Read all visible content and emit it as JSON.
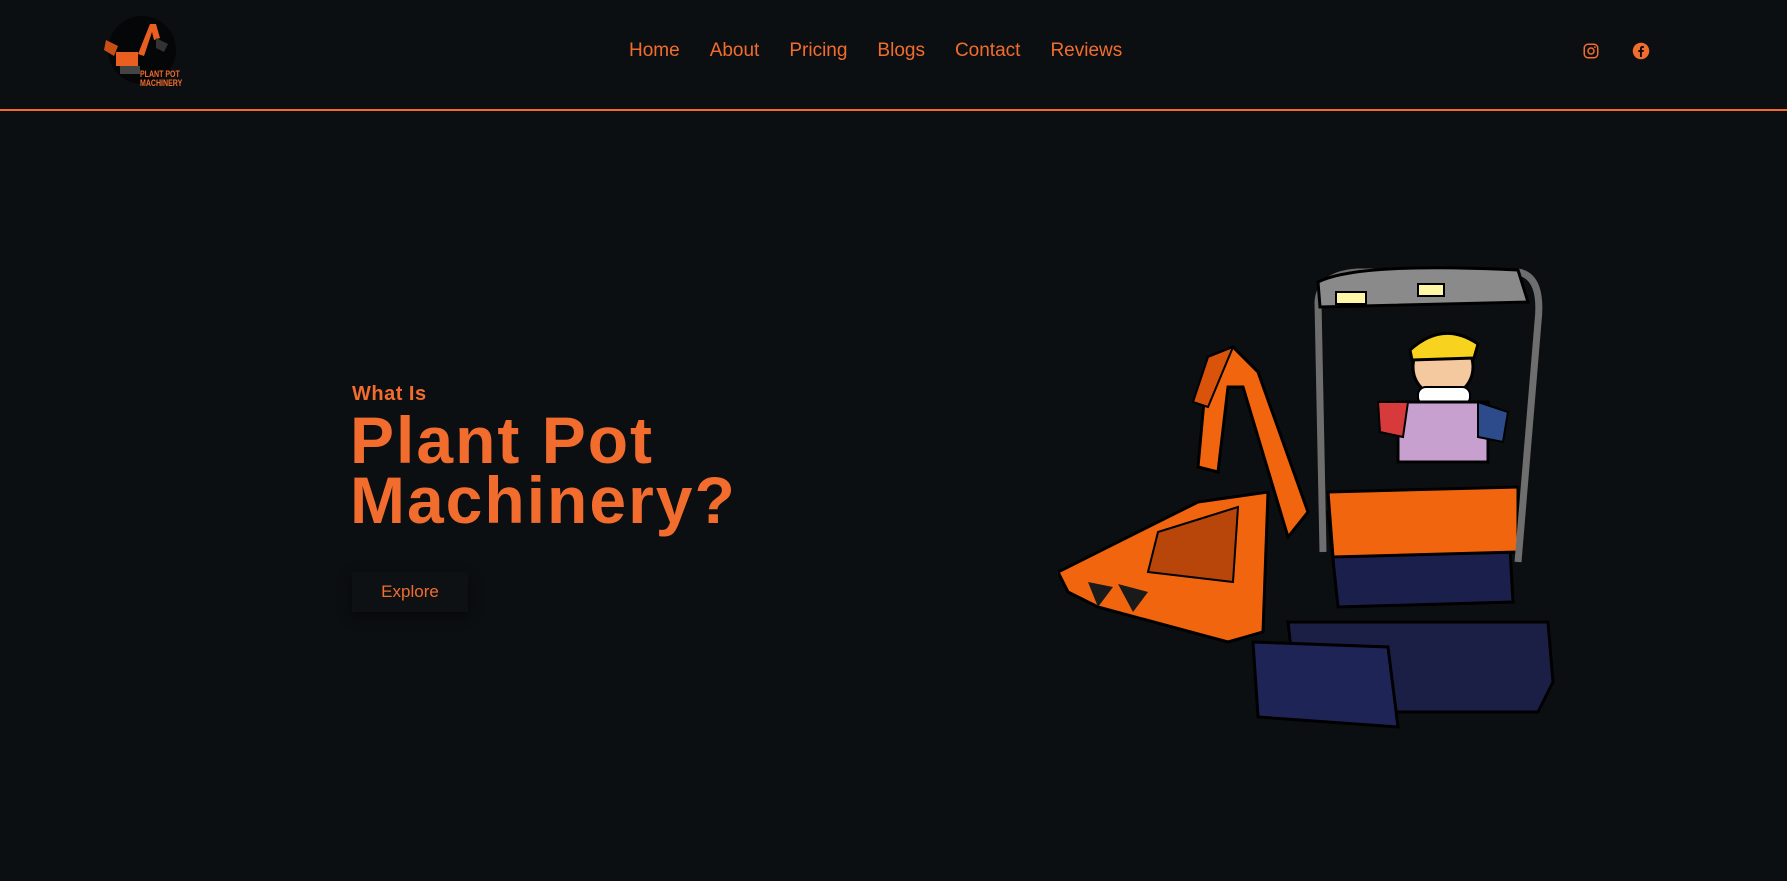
{
  "brand": {
    "logo_text_line1": "PLANT POT",
    "logo_text_line2": "MACHINERY",
    "accent_color": "#f26d2d",
    "background_color": "#0c0f12"
  },
  "nav": {
    "items": [
      {
        "label": "Home"
      },
      {
        "label": "About"
      },
      {
        "label": "Pricing"
      },
      {
        "label": "Blogs"
      },
      {
        "label": "Contact"
      },
      {
        "label": "Reviews"
      }
    ]
  },
  "social": {
    "icons": [
      "instagram-icon",
      "facebook-icon"
    ]
  },
  "hero": {
    "kicker": "What Is",
    "title_line1": "Plant Pot",
    "title_line2": "Machinery?",
    "cta_label": "Explore"
  }
}
